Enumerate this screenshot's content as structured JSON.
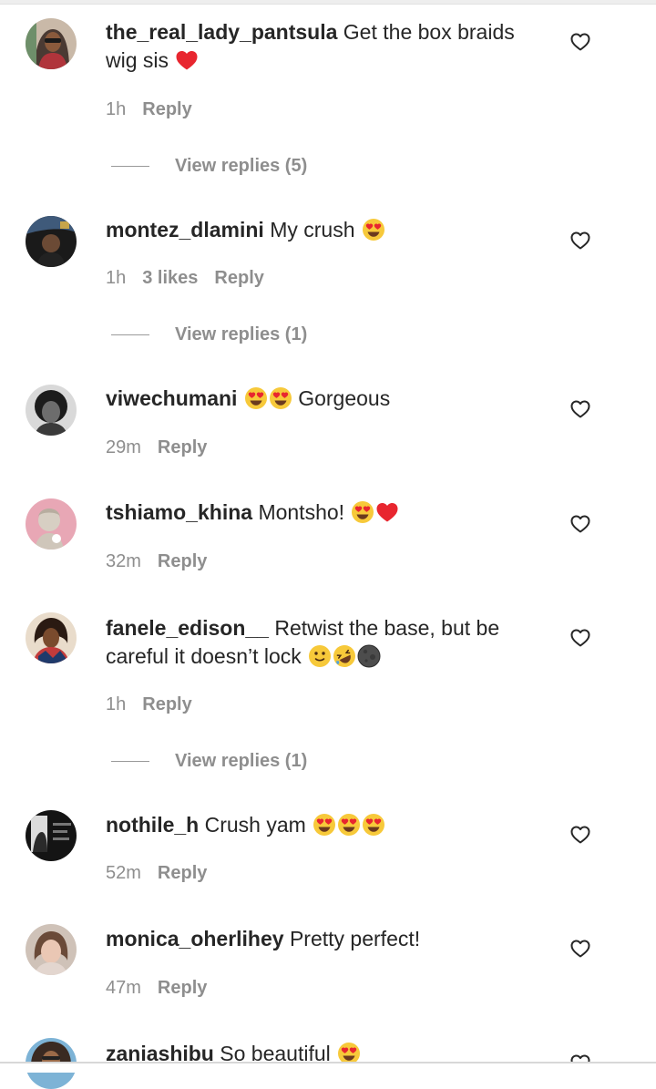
{
  "comments": [
    {
      "username": "the_real_lady_pantsula",
      "text": "Get the box braids wig sis",
      "emojis": [
        "red-heart"
      ],
      "time": "1h",
      "likes": "",
      "reply": "Reply",
      "view_replies": "View replies (5)"
    },
    {
      "username": "montez_dlamini",
      "text": "My crush",
      "emojis": [
        "heart-eyes"
      ],
      "time": "1h",
      "likes": "3 likes",
      "reply": "Reply",
      "view_replies": "View replies (1)"
    },
    {
      "username": "viwechumani",
      "text": "Gorgeous",
      "emojis_before": [
        "heart-eyes",
        "heart-eyes"
      ],
      "time": "29m",
      "reply": "Reply"
    },
    {
      "username": "tshiamo_khina",
      "text": "Montsho!",
      "emojis": [
        "heart-eyes",
        "red-heart"
      ],
      "time": "32m",
      "reply": "Reply"
    },
    {
      "username": "fanele_edison__",
      "text": "Retwist the base, but be careful it doesn’t lock",
      "emojis": [
        "slightly-smiling",
        "rolling-laughing",
        "new-moon"
      ],
      "time": "1h",
      "reply": "Reply",
      "view_replies": "View replies (1)"
    },
    {
      "username": "nothile_h",
      "text": "Crush yam",
      "emojis": [
        "heart-eyes",
        "heart-eyes",
        "heart-eyes"
      ],
      "time": "52m",
      "reply": "Reply"
    },
    {
      "username": "monica_oherlihey",
      "text": "Pretty perfect!",
      "time": "47m",
      "reply": "Reply"
    },
    {
      "username": "zaniashibu",
      "text": "So beautiful",
      "emojis": [
        "heart-eyes"
      ]
    }
  ],
  "icons": {
    "like": "heart-outline-icon"
  },
  "colors": {
    "text": "#262626",
    "secondary": "#8e8e8e"
  }
}
